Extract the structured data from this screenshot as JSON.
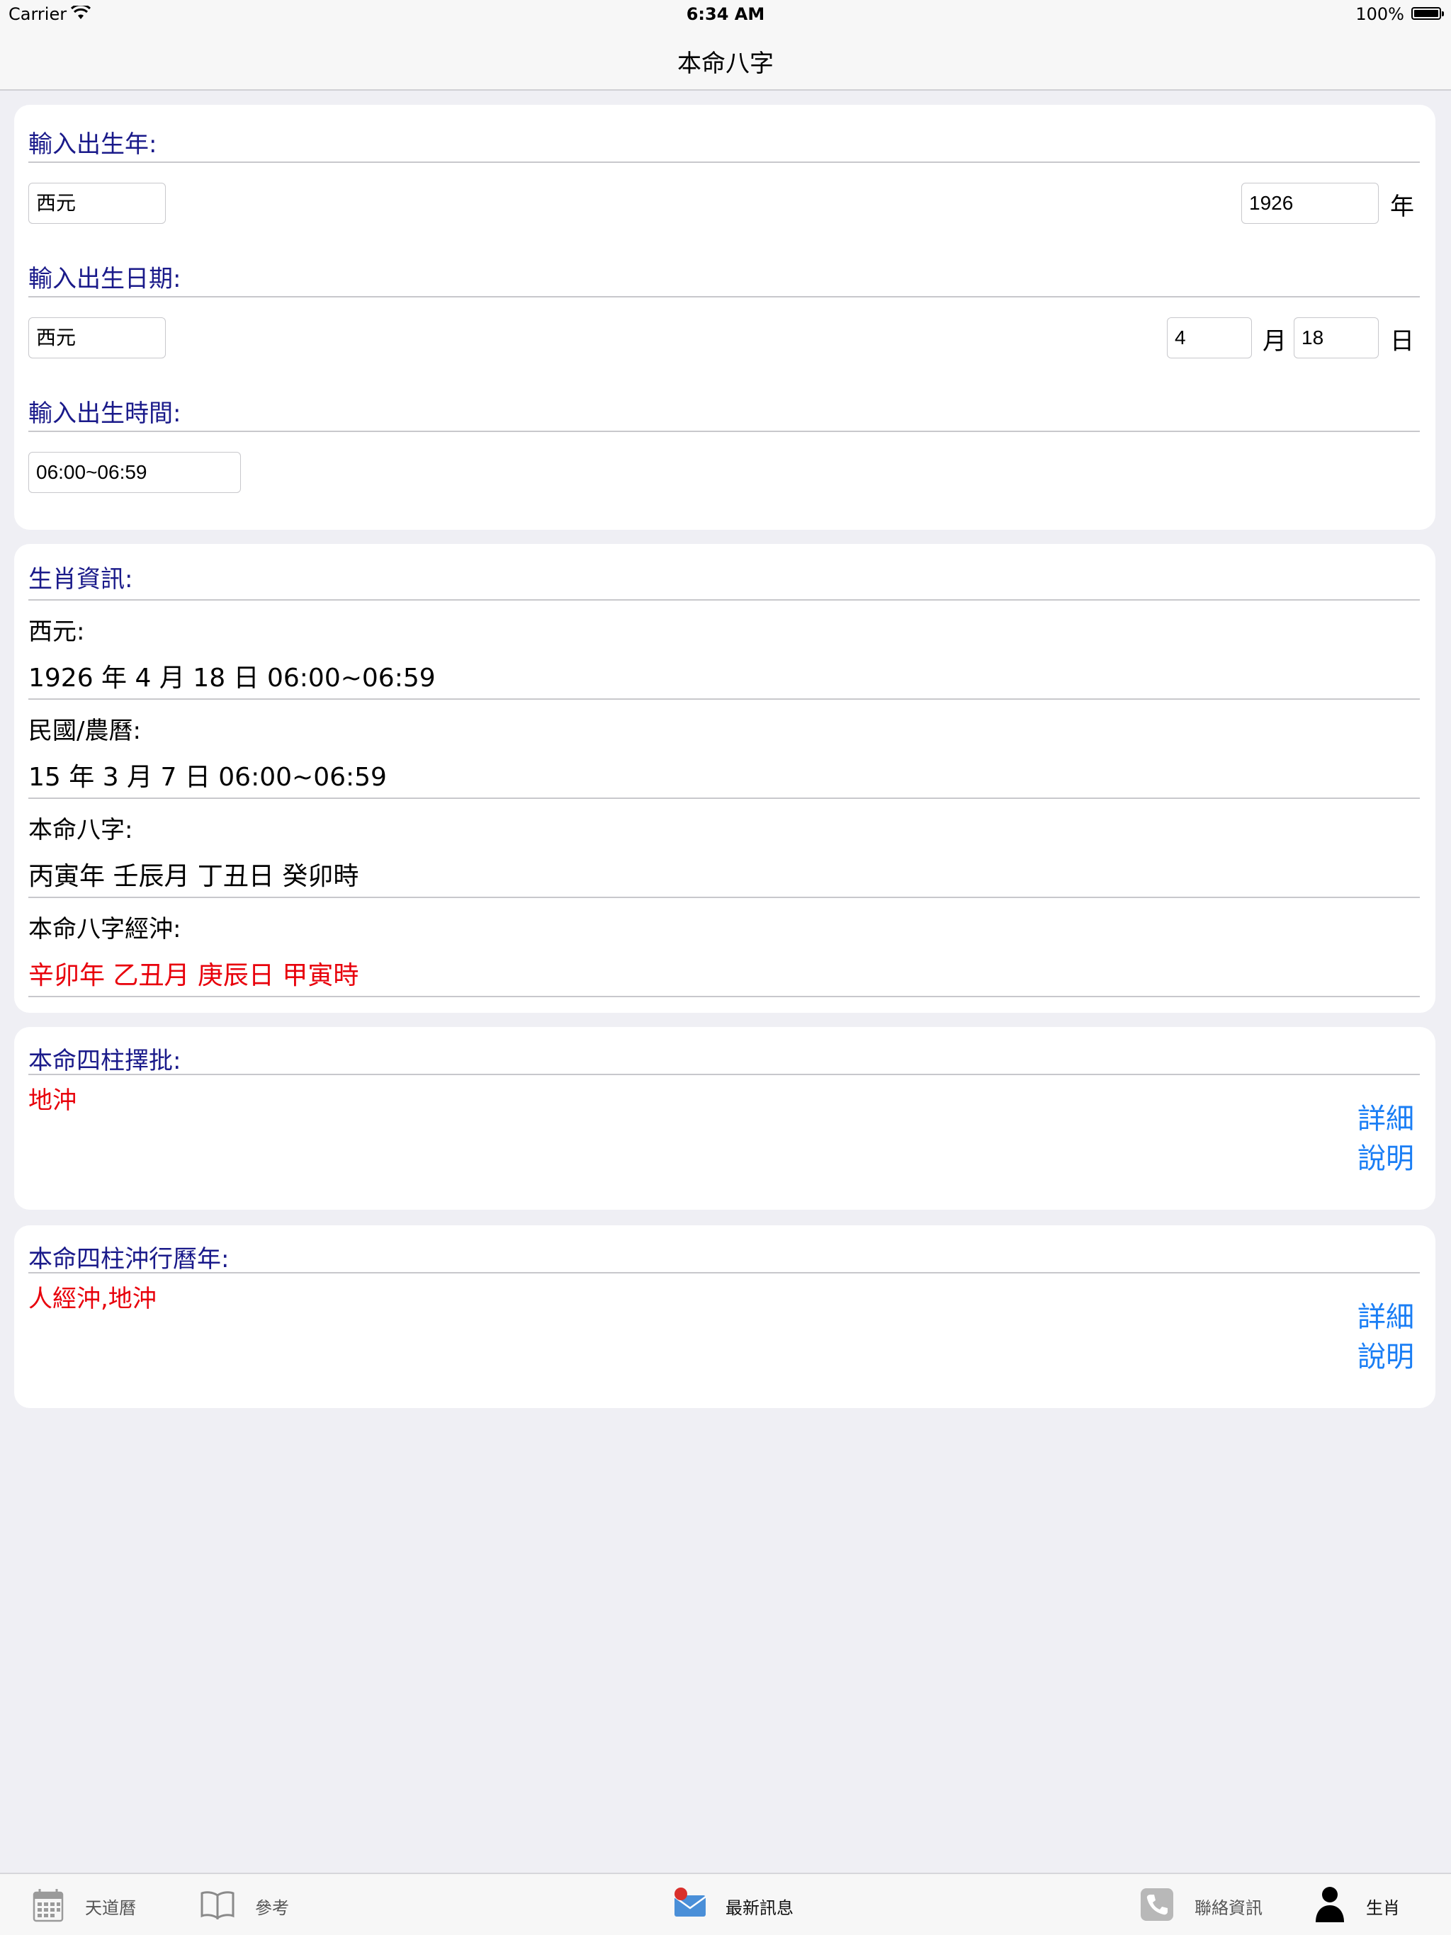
{
  "status_bar": {
    "carrier": "Carrier",
    "time": "6:34 AM",
    "battery": "100%"
  },
  "nav": {
    "title": "本命八字"
  },
  "input_card": {
    "year_title": "輸入出生年:",
    "year_era": "西元",
    "year_value": "1926",
    "year_unit": "年",
    "date_title": "輸入出生日期:",
    "date_era": "西元",
    "month_value": "4",
    "month_unit": "月",
    "day_value": "18",
    "day_unit": "日",
    "time_title": "輸入出生時間:",
    "time_value": "06:00~06:59"
  },
  "zodiac_card": {
    "title": "生肖資訊:",
    "western_label": "西元:",
    "western_value": "1926 年 4 月 18 日 06:00~06:59",
    "roc_label": "民國/農曆:",
    "roc_value": "15 年 3 月 7 日 06:00~06:59",
    "bazi_label": "本命八字:",
    "bazi_value": "丙寅年 壬辰月 丁丑日 癸卯時",
    "clash_label": "本命八字經沖:",
    "clash_value": "辛卯年 乙丑月 庚辰日 甲寅時"
  },
  "pillar_card": {
    "title": "本命四柱擇批:",
    "value": "地沖",
    "link_line1": "詳細",
    "link_line2": "說明"
  },
  "annual_card": {
    "title": "本命四柱沖行曆年:",
    "value": "人經沖,地沖",
    "link_line1": "詳細",
    "link_line2": "說明"
  },
  "tabs": [
    {
      "label": "天道曆",
      "icon": "calendar-icon"
    },
    {
      "label": "參考",
      "icon": "book-icon"
    },
    {
      "label": "最新訊息",
      "icon": "mail-icon"
    },
    {
      "label": "聯絡資訊",
      "icon": "phone-icon"
    },
    {
      "label": "生肖",
      "icon": "person-icon"
    }
  ],
  "colors": {
    "title_blue": "#1a1a8a",
    "red": "#e8000b",
    "link_blue": "#1a7ef5",
    "background": "#efeff4"
  }
}
